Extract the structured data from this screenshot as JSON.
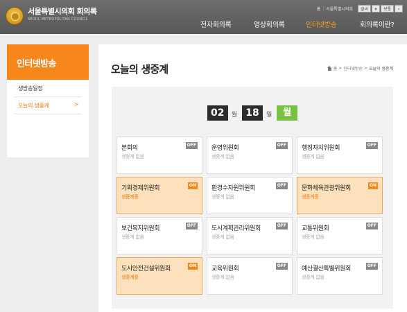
{
  "header": {
    "logo_title": "서울특별시의회 회의록",
    "logo_subtitle": "SEOUL METROPOLITAN COUNCIL",
    "util": {
      "home": "홈",
      "site": "서울특별시의회"
    },
    "font_size": {
      "label": "글씨",
      "plus": "+",
      "normal": "보통",
      "minus": "-"
    },
    "nav": [
      {
        "label": "전자회의록"
      },
      {
        "label": "영상회의록"
      },
      {
        "label": "인터넷방송",
        "active": true
      },
      {
        "label": "회의록이란?"
      }
    ]
  },
  "sidebar": {
    "title": "인터넷방송",
    "items": [
      {
        "label": "생방송일정"
      },
      {
        "label": "오늘의 생중계",
        "active": true,
        "arrow": ">"
      }
    ]
  },
  "content": {
    "title": "오늘의 생중계",
    "breadcrumb": {
      "home": "홈",
      "sep": ">",
      "section": "인터넷방송",
      "current": "오늘의 생중계"
    },
    "date": {
      "month": "02",
      "month_unit": "월",
      "day": "18",
      "day_unit": "일",
      "weekday": "월"
    },
    "committees": [
      {
        "name": "본회의",
        "badge": "OFF",
        "status": "생중계 없음"
      },
      {
        "name": "운영위원회",
        "badge": "OFF",
        "status": "생중계 없음"
      },
      {
        "name": "행정자치위원회",
        "badge": "OFF",
        "status": "생중계 없음"
      },
      {
        "name": "기획경제위원회",
        "badge": "ON",
        "status": "생중계중"
      },
      {
        "name": "환경수자원위원회",
        "badge": "OFF",
        "status": "생중계 없음"
      },
      {
        "name": "문화체육관광위원회",
        "badge": "ON",
        "status": "생중계중"
      },
      {
        "name": "보건복지위원회",
        "badge": "OFF",
        "status": "생중계 없음"
      },
      {
        "name": "도시계획관리위원회",
        "badge": "OFF",
        "status": "생중계 없음"
      },
      {
        "name": "교통위원회",
        "badge": "OFF",
        "status": "생중계 없음"
      },
      {
        "name": "도시안전건설위원회",
        "badge": "ON",
        "status": "생중계중"
      },
      {
        "name": "교육위원회",
        "badge": "OFF",
        "status": "생중계 없음"
      },
      {
        "name": "예산결산특별위원회",
        "badge": "OFF",
        "status": "생중계 없음"
      }
    ]
  },
  "colors": {
    "accent": "#f7861b",
    "on_card_bg": "#fce1bc",
    "weekday_bg": "#79c142",
    "header_bg": "#5f5f5f"
  }
}
